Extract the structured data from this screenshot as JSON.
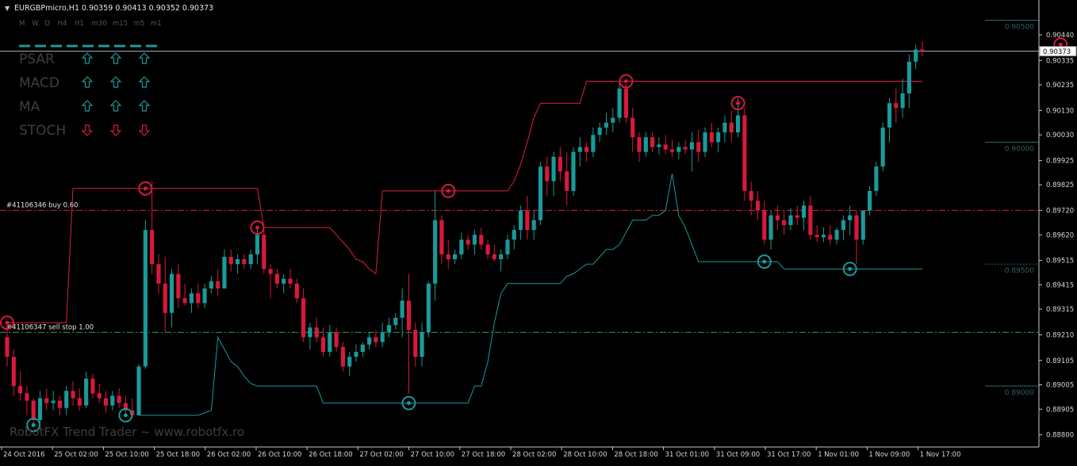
{
  "header": {
    "arrow": "▼",
    "symbol_line": "EURGBPmicro,H1  0.90359 0.90413 0.90352 0.90373",
    "timeframes": [
      "M",
      "W",
      "D",
      "H4",
      "H1",
      "m30",
      "m15",
      "m5",
      "m1"
    ]
  },
  "signal_table": {
    "rows": [
      {
        "label": "PSAR",
        "dirs": [
          "up",
          "up",
          "up"
        ]
      },
      {
        "label": "MACD",
        "dirs": [
          "up",
          "up",
          "up"
        ]
      },
      {
        "label": "MA",
        "dirs": [
          "up",
          "up",
          "up"
        ]
      },
      {
        "label": "STOCH",
        "dirs": [
          "down",
          "down",
          "down"
        ]
      }
    ],
    "up_color": "#1a9a9a",
    "down_color": "#d8193c"
  },
  "orders": [
    {
      "label": "#41106346 buy 0.60",
      "price": 0.8972,
      "color": "#d8193c"
    },
    {
      "label": "#41106347 sell stop 1.00",
      "price": 0.8922,
      "color": "#2e9a4c"
    }
  ],
  "current_price": {
    "value": 0.90373,
    "label": "0.90373"
  },
  "watermark": "RobotFX Trend Trader ~ www.robotfx.ro",
  "colors": {
    "background": "#000000",
    "bull": "#1a9a9a",
    "bear": "#d8193c",
    "upper_line": "#e0203c",
    "lower_line": "#1a9a9a",
    "axis": "#c8c8c8",
    "level": "#2a6a6a"
  },
  "chart_data": {
    "type": "candlestick",
    "ylim": [
      0.8875,
      0.9057
    ],
    "y_ticks": [
      0.9044,
      0.90335,
      0.90235,
      0.9013,
      0.9003,
      0.89925,
      0.89825,
      0.8972,
      0.8962,
      0.89515,
      0.89415,
      0.89315,
      0.8921,
      0.89105,
      0.89005,
      0.88905,
      0.888
    ],
    "y_tick_labels": [
      "0.90440",
      "0.90335",
      "0.90235",
      "0.90130",
      "0.90030",
      "0.89925",
      "0.89825",
      "0.89720",
      "0.89620",
      "0.89515",
      "0.89415",
      "0.89315",
      "0.89210",
      "0.89105",
      "0.89005",
      "0.88905",
      "0.88800"
    ],
    "x_labels": [
      "24 Oct 2016",
      "25 Oct 02:00",
      "25 Oct 10:00",
      "25 Oct 18:00",
      "26 Oct 02:00",
      "26 Oct 10:00",
      "26 Oct 18:00",
      "27 Oct 02:00",
      "27 Oct 10:00",
      "27 Oct 18:00",
      "28 Oct 02:00",
      "28 Oct 10:00",
      "28 Oct 18:00",
      "31 Oct 01:00",
      "31 Oct 09:00",
      "31 Oct 17:00",
      "1 Nov 01:00",
      "1 Nov 09:00",
      "1 Nov 17:00"
    ],
    "levels": [
      {
        "label": "0.90500",
        "value": 0.905
      },
      {
        "label": "0.90000",
        "value": 0.9
      },
      {
        "label": "0.89500",
        "value": 0.895
      },
      {
        "label": "0.89000",
        "value": 0.89
      }
    ],
    "candles": [
      [
        0.892,
        0.8926,
        0.8908,
        0.8912
      ],
      [
        0.8912,
        0.8915,
        0.8896,
        0.89
      ],
      [
        0.89,
        0.8906,
        0.8894,
        0.8897
      ],
      [
        0.8897,
        0.89,
        0.8888,
        0.8894
      ],
      [
        0.8894,
        0.8895,
        0.8884,
        0.8886
      ],
      [
        0.8886,
        0.8898,
        0.8885,
        0.8895
      ],
      [
        0.8895,
        0.8899,
        0.889,
        0.8893
      ],
      [
        0.8893,
        0.8898,
        0.889,
        0.8894
      ],
      [
        0.8894,
        0.8896,
        0.8888,
        0.8891
      ],
      [
        0.8891,
        0.89,
        0.8888,
        0.8898
      ],
      [
        0.8898,
        0.8902,
        0.8892,
        0.8895
      ],
      [
        0.8895,
        0.8899,
        0.889,
        0.8892
      ],
      [
        0.8892,
        0.8906,
        0.8891,
        0.8903
      ],
      [
        0.8903,
        0.8905,
        0.8895,
        0.8897
      ],
      [
        0.8897,
        0.8901,
        0.8893,
        0.8895
      ],
      [
        0.8895,
        0.8898,
        0.8889,
        0.8892
      ],
      [
        0.8892,
        0.8898,
        0.889,
        0.8896
      ],
      [
        0.8896,
        0.8899,
        0.8891,
        0.8893
      ],
      [
        0.8893,
        0.8896,
        0.8888,
        0.889
      ],
      [
        0.889,
        0.8895,
        0.8887,
        0.8888
      ],
      [
        0.8888,
        0.8909,
        0.8888,
        0.8908
      ],
      [
        0.8908,
        0.8968,
        0.8907,
        0.8964
      ],
      [
        0.8964,
        0.8984,
        0.8946,
        0.895
      ],
      [
        0.895,
        0.8954,
        0.8938,
        0.8942
      ],
      [
        0.8942,
        0.8953,
        0.8922,
        0.893
      ],
      [
        0.893,
        0.8948,
        0.8924,
        0.8946
      ],
      [
        0.8946,
        0.895,
        0.8932,
        0.8936
      ],
      [
        0.8936,
        0.8942,
        0.8933,
        0.8934
      ],
      [
        0.8934,
        0.894,
        0.893,
        0.8938
      ],
      [
        0.8938,
        0.8942,
        0.8932,
        0.8934
      ],
      [
        0.8934,
        0.8942,
        0.8932,
        0.894
      ],
      [
        0.894,
        0.8945,
        0.8938,
        0.8943
      ],
      [
        0.8943,
        0.8948,
        0.8937,
        0.894
      ],
      [
        0.894,
        0.8956,
        0.894,
        0.8953
      ],
      [
        0.8953,
        0.8956,
        0.8947,
        0.895
      ],
      [
        0.895,
        0.8954,
        0.8946,
        0.8952
      ],
      [
        0.8952,
        0.8954,
        0.8948,
        0.895
      ],
      [
        0.895,
        0.8956,
        0.8948,
        0.8954
      ],
      [
        0.8954,
        0.8965,
        0.895,
        0.8962
      ],
      [
        0.8962,
        0.8964,
        0.8946,
        0.8948
      ],
      [
        0.8948,
        0.895,
        0.8936,
        0.8946
      ],
      [
        0.8946,
        0.8948,
        0.894,
        0.8942
      ],
      [
        0.8942,
        0.8946,
        0.8938,
        0.8944
      ],
      [
        0.8944,
        0.8948,
        0.894,
        0.8942
      ],
      [
        0.8942,
        0.8944,
        0.8934,
        0.8936
      ],
      [
        0.8936,
        0.894,
        0.8918,
        0.892
      ],
      [
        0.892,
        0.8926,
        0.8915,
        0.8924
      ],
      [
        0.8924,
        0.8928,
        0.8918,
        0.892
      ],
      [
        0.892,
        0.8924,
        0.8912,
        0.8914
      ],
      [
        0.8914,
        0.8925,
        0.8912,
        0.8922
      ],
      [
        0.8922,
        0.8924,
        0.8914,
        0.8916
      ],
      [
        0.8916,
        0.8918,
        0.8906,
        0.8908
      ],
      [
        0.8908,
        0.8914,
        0.8904,
        0.8912
      ],
      [
        0.8912,
        0.8917,
        0.891,
        0.8914
      ],
      [
        0.8914,
        0.8918,
        0.8912,
        0.8917
      ],
      [
        0.8917,
        0.8922,
        0.8915,
        0.892
      ],
      [
        0.892,
        0.8923,
        0.8916,
        0.8918
      ],
      [
        0.8918,
        0.8926,
        0.8916,
        0.8922
      ],
      [
        0.8922,
        0.8928,
        0.892,
        0.8925
      ],
      [
        0.8925,
        0.893,
        0.8923,
        0.8928
      ],
      [
        0.8928,
        0.894,
        0.892,
        0.8935
      ],
      [
        0.8935,
        0.8946,
        0.8897,
        0.8923
      ],
      [
        0.8923,
        0.8926,
        0.8908,
        0.8912
      ],
      [
        0.8912,
        0.8926,
        0.8908,
        0.8922
      ],
      [
        0.8922,
        0.8943,
        0.892,
        0.8942
      ],
      [
        0.8942,
        0.898,
        0.8935,
        0.8968
      ],
      [
        0.8968,
        0.897,
        0.895,
        0.8954
      ],
      [
        0.8954,
        0.896,
        0.8948,
        0.8952
      ],
      [
        0.8952,
        0.8956,
        0.895,
        0.8954
      ],
      [
        0.8954,
        0.8963,
        0.8952,
        0.896
      ],
      [
        0.896,
        0.8962,
        0.8956,
        0.8958
      ],
      [
        0.8958,
        0.8964,
        0.8954,
        0.8962
      ],
      [
        0.8962,
        0.8965,
        0.8956,
        0.8958
      ],
      [
        0.8958,
        0.896,
        0.8952,
        0.8954
      ],
      [
        0.8954,
        0.8958,
        0.8951,
        0.8952
      ],
      [
        0.8952,
        0.8956,
        0.8947,
        0.8954
      ],
      [
        0.8954,
        0.8962,
        0.8952,
        0.896
      ],
      [
        0.896,
        0.8966,
        0.8956,
        0.8964
      ],
      [
        0.8964,
        0.8974,
        0.896,
        0.8972
      ],
      [
        0.8972,
        0.8978,
        0.896,
        0.8964
      ],
      [
        0.8964,
        0.8972,
        0.896,
        0.8968
      ],
      [
        0.8968,
        0.8992,
        0.8966,
        0.899
      ],
      [
        0.899,
        0.8994,
        0.8978,
        0.8984
      ],
      [
        0.8984,
        0.8996,
        0.8978,
        0.8994
      ],
      [
        0.8994,
        0.8998,
        0.8984,
        0.8988
      ],
      [
        0.8988,
        0.8996,
        0.8974,
        0.898
      ],
      [
        0.898,
        0.8998,
        0.8978,
        0.8996
      ],
      [
        0.8996,
        0.9002,
        0.899,
        0.8998
      ],
      [
        0.8998,
        0.9,
        0.8992,
        0.8996
      ],
      [
        0.8996,
        0.9006,
        0.8994,
        0.9003
      ],
      [
        0.9003,
        0.9008,
        0.9,
        0.9006
      ],
      [
        0.9006,
        0.9012,
        0.9003,
        0.9008
      ],
      [
        0.9008,
        0.9014,
        0.9004,
        0.901
      ],
      [
        0.901,
        0.9025,
        0.9008,
        0.9022
      ],
      [
        0.9022,
        0.9024,
        0.9008,
        0.901
      ],
      [
        0.901,
        0.9014,
        0.8996,
        0.9002
      ],
      [
        0.9002,
        0.9004,
        0.8992,
        0.8996
      ],
      [
        0.8996,
        0.9004,
        0.8994,
        0.9002
      ],
      [
        0.9002,
        0.9004,
        0.8996,
        0.8998
      ],
      [
        0.8998,
        0.9002,
        0.8995,
        0.8999
      ],
      [
        0.8999,
        0.9003,
        0.8995,
        0.8997
      ],
      [
        0.8997,
        0.9001,
        0.8994,
        0.8996
      ],
      [
        0.8996,
        0.9,
        0.8993,
        0.8998
      ],
      [
        0.8998,
        0.9001,
        0.8995,
        0.8997
      ],
      [
        0.8997,
        0.9004,
        0.8988,
        0.9
      ],
      [
        0.9,
        0.9005,
        0.8992,
        0.8996
      ],
      [
        0.8996,
        0.9006,
        0.8994,
        0.9004
      ],
      [
        0.9004,
        0.9008,
        0.8998,
        0.9
      ],
      [
        0.9,
        0.9006,
        0.8996,
        0.9004
      ],
      [
        0.9004,
        0.9011,
        0.9,
        0.9008
      ],
      [
        0.9008,
        0.9013,
        0.9,
        0.9004
      ],
      [
        0.9004,
        0.9018,
        0.9002,
        0.9011
      ],
      [
        0.9011,
        0.9014,
        0.8976,
        0.898
      ],
      [
        0.898,
        0.8984,
        0.897,
        0.8976
      ],
      [
        0.8976,
        0.898,
        0.8968,
        0.8972
      ],
      [
        0.8972,
        0.8976,
        0.8958,
        0.896
      ],
      [
        0.896,
        0.8972,
        0.8956,
        0.897
      ],
      [
        0.897,
        0.8974,
        0.8964,
        0.8968
      ],
      [
        0.8968,
        0.8972,
        0.8962,
        0.8966
      ],
      [
        0.8966,
        0.8973,
        0.8964,
        0.897
      ],
      [
        0.897,
        0.8974,
        0.8966,
        0.8969
      ],
      [
        0.8969,
        0.8976,
        0.8964,
        0.8974
      ],
      [
        0.8974,
        0.8978,
        0.896,
        0.8962
      ],
      [
        0.8962,
        0.8966,
        0.8959,
        0.8961
      ],
      [
        0.8961,
        0.8965,
        0.8959,
        0.8962
      ],
      [
        0.8962,
        0.8966,
        0.8958,
        0.896
      ],
      [
        0.896,
        0.8965,
        0.8958,
        0.8964
      ],
      [
        0.8964,
        0.897,
        0.896,
        0.8968
      ],
      [
        0.8968,
        0.8974,
        0.8962,
        0.897
      ],
      [
        0.897,
        0.8972,
        0.895,
        0.896
      ],
      [
        0.896,
        0.8972,
        0.8958,
        0.8972
      ],
      [
        0.8972,
        0.8982,
        0.897,
        0.898
      ],
      [
        0.898,
        0.8992,
        0.8978,
        0.899
      ],
      [
        0.899,
        0.9008,
        0.8988,
        0.9006
      ],
      [
        0.9006,
        0.9018,
        0.9,
        0.9016
      ],
      [
        0.9016,
        0.9022,
        0.9008,
        0.9014
      ],
      [
        0.9014,
        0.9026,
        0.901,
        0.902
      ],
      [
        0.902,
        0.9036,
        0.9014,
        0.9033
      ],
      [
        0.9033,
        0.904,
        0.903,
        0.9038
      ],
      [
        0.9038,
        0.90413,
        0.90352,
        0.90373
      ]
    ],
    "upper_line": [
      0.8926,
      0.8926,
      0.8926,
      0.8926,
      0.8926,
      0.8926,
      0.8926,
      0.8926,
      0.8926,
      0.8926,
      0.8981,
      0.8981,
      0.8981,
      0.8981,
      0.8981,
      0.8981,
      0.8981,
      0.8981,
      0.8981,
      0.8981,
      0.8981,
      0.8981,
      0.8981,
      0.8981,
      0.8981,
      0.8981,
      0.8981,
      0.8981,
      0.8981,
      0.8981,
      0.8981,
      0.8981,
      0.8981,
      0.8981,
      0.8981,
      0.8981,
      0.8981,
      0.8981,
      0.8981,
      0.8965,
      0.8965,
      0.8965,
      0.8965,
      0.8965,
      0.8965,
      0.8965,
      0.8965,
      0.8965,
      0.8965,
      0.8965,
      0.8962,
      0.8959,
      0.8956,
      0.8952,
      0.8951,
      0.8948,
      0.8946,
      0.898,
      0.898,
      0.898,
      0.898,
      0.898,
      0.898,
      0.898,
      0.898,
      0.898,
      0.898,
      0.898,
      0.898,
      0.898,
      0.898,
      0.898,
      0.898,
      0.898,
      0.898,
      0.898,
      0.898,
      0.8984,
      0.8991,
      0.9,
      0.901,
      0.9016,
      0.9016,
      0.9016,
      0.9016,
      0.9016,
      0.9016,
      0.9016,
      0.9025,
      0.9025,
      0.9025,
      0.9025,
      0.9025,
      0.9025,
      0.9025,
      0.9025,
      0.9025,
      0.9025,
      0.9025,
      0.9025,
      0.9025,
      0.9025,
      0.9025,
      0.9025,
      0.9025,
      0.9025,
      0.9025,
      0.9025,
      0.9025,
      0.9025,
      0.9025,
      0.9025,
      0.9025,
      0.9025,
      0.9025,
      0.9025,
      0.9025,
      0.9025,
      0.9025,
      0.9025,
      0.9025,
      0.9025,
      0.9025,
      0.9025,
      0.9025,
      0.9025,
      0.9025,
      0.9025,
      0.9025,
      0.9025,
      0.9025,
      0.9025,
      0.9025,
      0.9025,
      0.9025,
      0.9025,
      0.9025,
      0.9025,
      0.9025,
      0.9025
    ],
    "lower_line": [
      null,
      null,
      null,
      null,
      null,
      null,
      null,
      null,
      null,
      null,
      null,
      null,
      null,
      null,
      null,
      null,
      null,
      null,
      null,
      null,
      0.8888,
      0.8888,
      0.8888,
      0.8888,
      0.8888,
      0.8888,
      0.8888,
      0.8888,
      0.8888,
      0.8888,
      0.8889,
      0.889,
      0.892,
      0.8915,
      0.891,
      0.8908,
      0.8904,
      0.8901,
      0.89,
      0.89,
      0.89,
      0.89,
      0.89,
      0.89,
      0.89,
      0.89,
      0.89,
      0.89,
      0.8893,
      0.8893,
      0.8893,
      0.8893,
      0.8893,
      0.8893,
      0.8893,
      0.8893,
      0.8893,
      0.8893,
      0.8893,
      0.8893,
      0.8893,
      0.8893,
      0.8893,
      0.8893,
      0.8893,
      0.8893,
      0.8893,
      0.8893,
      0.8893,
      0.8893,
      0.8893,
      0.89,
      0.89,
      0.891,
      0.8926,
      0.8938,
      0.8942,
      0.8942,
      0.8942,
      0.8942,
      0.8942,
      0.8942,
      0.8942,
      0.8942,
      0.8942,
      0.8945,
      0.8946,
      0.8948,
      0.895,
      0.895,
      0.8953,
      0.8956,
      0.8956,
      0.8958,
      0.8963,
      0.8968,
      0.8968,
      0.8968,
      0.897,
      0.897,
      0.8972,
      0.8987,
      0.897,
      0.8965,
      0.8958,
      0.8951,
      0.8951,
      0.8951,
      0.8951,
      0.8951,
      0.8951,
      0.8951,
      0.8951,
      0.8951,
      0.8951,
      0.8951,
      0.8951,
      0.8951,
      0.8948,
      0.8948,
      0.8948,
      0.8948,
      0.8948,
      0.8948,
      0.8948,
      0.8948,
      0.8948,
      0.8948,
      0.8948,
      0.8948,
      0.8948,
      0.8948,
      0.8948,
      0.8948,
      0.8948,
      0.8948,
      0.8948,
      0.8948,
      0.8948,
      0.8948,
      0.8948,
      0.8948,
      0.8948,
      0.8948,
      0.8948
    ],
    "markers": [
      {
        "index": 0,
        "price": 0.8926,
        "kind": "upper"
      },
      {
        "index": 21,
        "price": 0.8981,
        "kind": "upper"
      },
      {
        "index": 38,
        "price": 0.8965,
        "kind": "upper"
      },
      {
        "index": 67,
        "price": 0.898,
        "kind": "upper"
      },
      {
        "index": 94,
        "price": 0.9025,
        "kind": "upper"
      },
      {
        "index": 111,
        "price": 0.9016,
        "kind": "upper"
      },
      {
        "index": 160,
        "price": 0.904,
        "kind": "upper"
      },
      {
        "index": 4,
        "price": 0.8884,
        "kind": "lower"
      },
      {
        "index": 18,
        "price": 0.8888,
        "kind": "lower"
      },
      {
        "index": 61,
        "price": 0.8893,
        "kind": "lower"
      },
      {
        "index": 115,
        "price": 0.8951,
        "kind": "lower"
      },
      {
        "index": 128,
        "price": 0.8948,
        "kind": "lower"
      }
    ]
  }
}
